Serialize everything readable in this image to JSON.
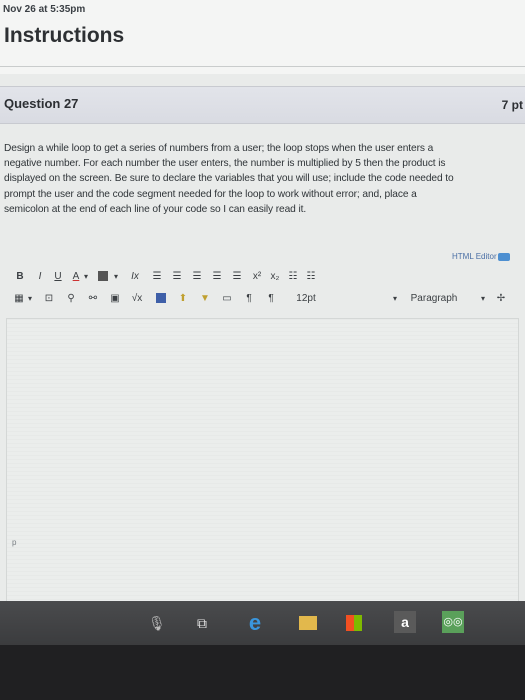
{
  "status": {
    "datetime": "Nov 26 at 5:35pm"
  },
  "page": {
    "title": "Instructions"
  },
  "question": {
    "title": "Question 27",
    "points": "7 pt",
    "lines": [
      "Design a while loop to get a series of numbers from a user; the loop stops when the user enters a",
      "negative number. For each number the user enters, the number is multiplied by 5 then the product is",
      "displayed on the screen. Be sure to declare the variables that you will use; include the code needed to",
      "prompt the user and the code segment needed for the loop to work without error; and, place a",
      "semicolon at the end of each line of your code so I can easily read it."
    ]
  },
  "editor": {
    "html_editor_link": "HTML Editor",
    "toolbar1": {
      "bold": "B",
      "italic": "I",
      "underline": "U",
      "text_color": "A",
      "caret": "▾",
      "clear_format": "Ix",
      "superscript": "x²",
      "subscript": "x₂"
    },
    "toolbar2": {
      "font_size": "12pt",
      "format": "Paragraph",
      "caret": "▾"
    },
    "path_marker": "p"
  },
  "taskbar": {
    "amazon_label": "a"
  }
}
